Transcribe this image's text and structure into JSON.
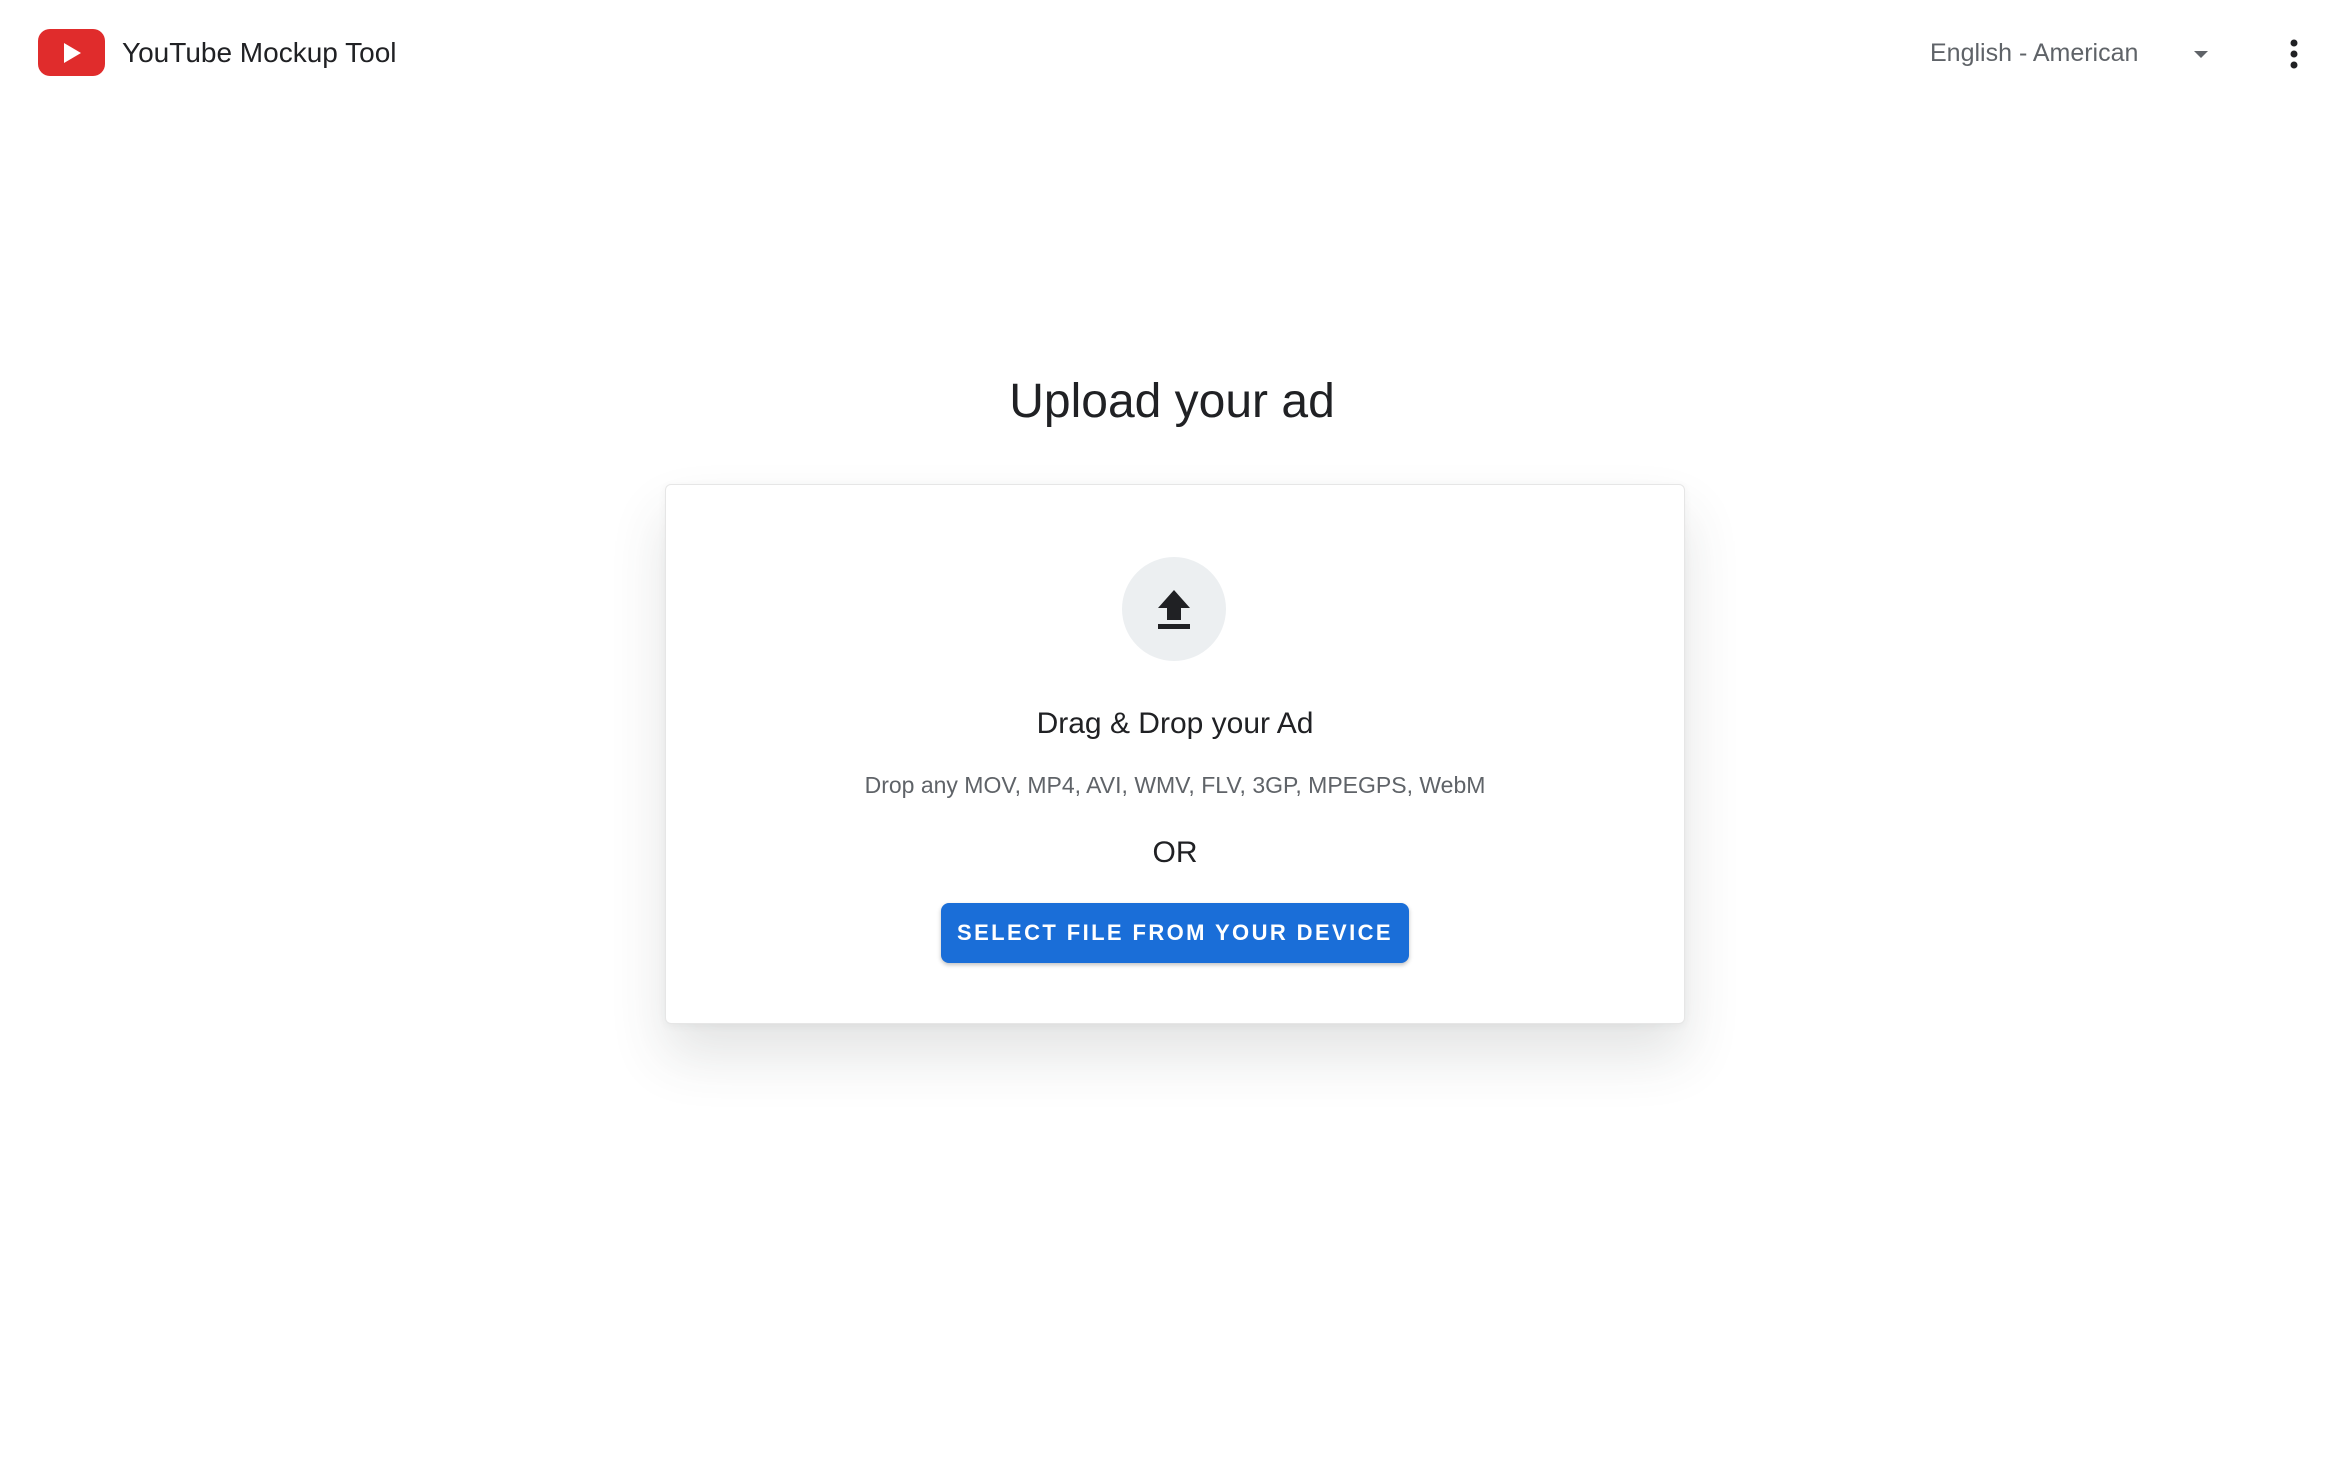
{
  "header": {
    "app_title": "YouTube Mockup Tool",
    "language": "English - American",
    "logo_icon": "youtube-play-icon",
    "language_caret_icon": "caret-down-icon",
    "menu_icon": "more-vert-icon"
  },
  "main": {
    "title": "Upload your ad",
    "upload_card": {
      "icon": "upload-icon",
      "heading": "Drag & Drop your Ad",
      "formats": "Drop any MOV, MP4, AVI, WMV, FLV, 3GP, MPEGPS, WebM",
      "or_label": "OR",
      "button_label": "SELECT FILE FROM YOUR DEVICE"
    }
  },
  "colors": {
    "brand_red": "#e02c2c",
    "primary_blue": "#1a6ed8",
    "text_primary": "#202124",
    "text_secondary": "#5f6368",
    "icon_bg": "#eceff1"
  }
}
